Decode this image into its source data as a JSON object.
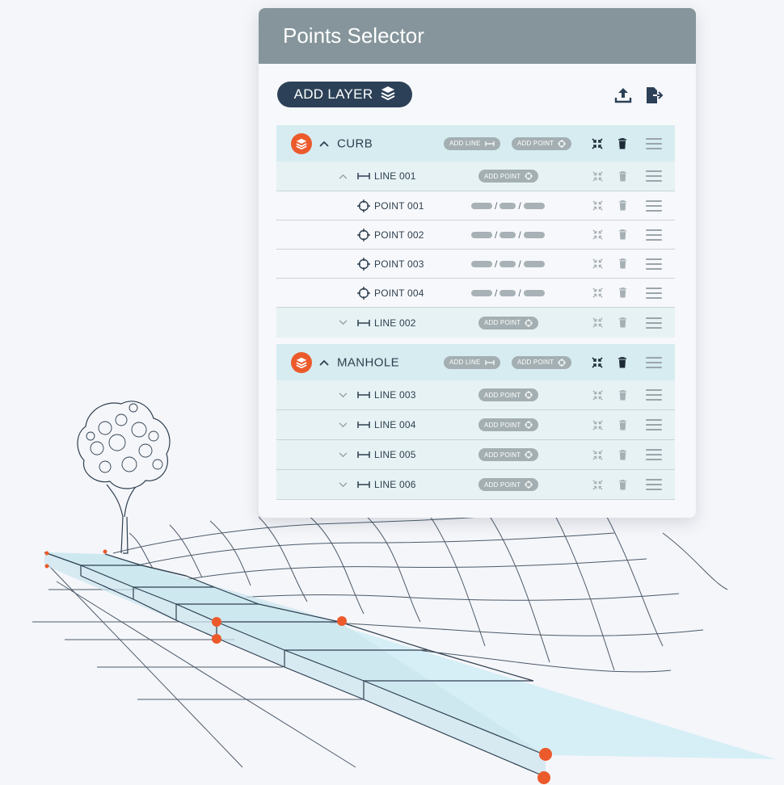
{
  "panel": {
    "title": "Points Selector"
  },
  "toolbar": {
    "add_layer_label": "ADD LAYER",
    "icons": [
      "upload-icon",
      "export-file-icon"
    ]
  },
  "chips": {
    "add_line": "ADD LINE",
    "add_point": "ADD POINT"
  },
  "coordinate_separator": "/",
  "layers": [
    {
      "name": "CURB",
      "expanded": true,
      "lines": [
        {
          "name": "LINE 001",
          "expanded": true,
          "points": [
            "POINT 001",
            "POINT 002",
            "POINT 003",
            "POINT 004"
          ]
        },
        {
          "name": "LINE 002",
          "expanded": false,
          "points": []
        }
      ]
    },
    {
      "name": "MANHOLE",
      "expanded": true,
      "lines": [
        {
          "name": "LINE 003",
          "expanded": false,
          "points": []
        },
        {
          "name": "LINE 004",
          "expanded": false,
          "points": []
        },
        {
          "name": "LINE 005",
          "expanded": false,
          "points": []
        },
        {
          "name": "LINE 006",
          "expanded": false,
          "points": []
        }
      ]
    }
  ],
  "colors": {
    "header": "#85959b",
    "accent": "#ec5a2b",
    "button": "#2c4157",
    "layer_row": "#d6ecf1",
    "line_row": "#e6f2f3",
    "sidewalk_fill": "#d6eff6",
    "ink": "#2e3f4f"
  },
  "icons": {
    "layer": "layers-icon",
    "line": "line-segment-icon",
    "point": "crosshair-target-icon",
    "collapse": "collapse-arrows-icon",
    "delete": "trash-icon",
    "drag": "drag-handle-icon"
  }
}
